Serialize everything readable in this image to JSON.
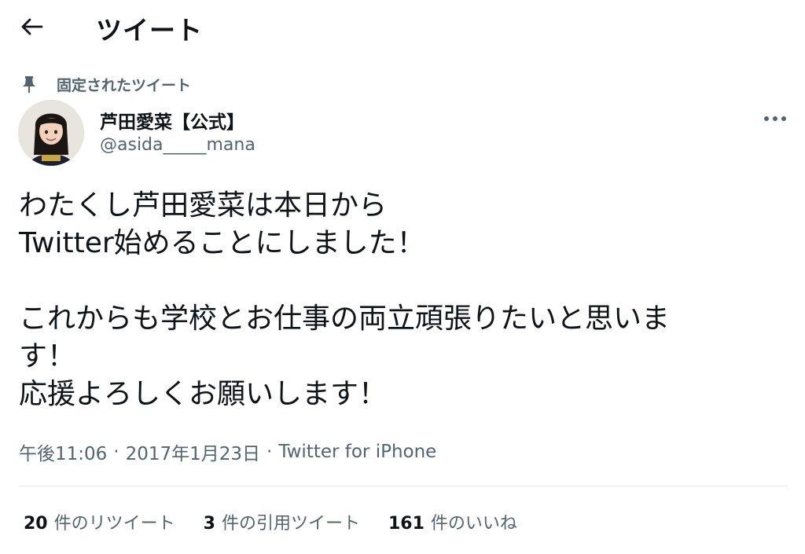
{
  "header": {
    "title": "ツイート"
  },
  "pinned": {
    "label": "固定されたツイート"
  },
  "author": {
    "name": "芦田愛菜【公式】",
    "handle": "@asida_____mana"
  },
  "tweet": {
    "text": "わたくし芦田愛菜は本日から\nTwitter始めることにしました！\n\nこれからも学校とお仕事の両立頑張りたいと思いま\nす！\n応援よろしくお願いします！",
    "time": "午後11:06",
    "date": "2017年1月23日",
    "source": "Twitter for iPhone",
    "separator": "·"
  },
  "stats": {
    "retweets": {
      "count": "20",
      "label": "件のリツイート"
    },
    "quotes": {
      "count": "3",
      "label": "件の引用ツイート"
    },
    "likes": {
      "count": "161",
      "label": "件のいいね"
    }
  },
  "icons": {
    "back": "arrow-left-icon",
    "pin": "pin-icon",
    "more": "more-horizontal-icon"
  },
  "colors": {
    "text_primary": "#0f1419",
    "text_secondary": "#536471",
    "divider": "#e6e9eb"
  }
}
